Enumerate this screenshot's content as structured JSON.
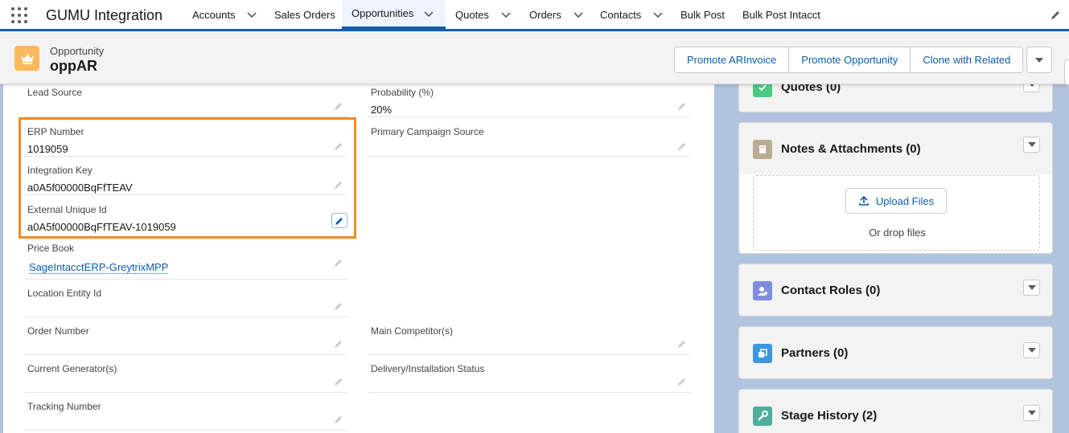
{
  "app": {
    "name": "GUMU Integration"
  },
  "nav": {
    "items": [
      {
        "label": "Accounts"
      },
      {
        "label": "Sales Orders"
      },
      {
        "label": "Opportunities"
      },
      {
        "label": "Quotes"
      },
      {
        "label": "Orders"
      },
      {
        "label": "Contacts"
      },
      {
        "label": "Bulk Post"
      },
      {
        "label": "Bulk Post Intacct"
      }
    ],
    "active": "Opportunities"
  },
  "record": {
    "type": "Opportunity",
    "name": "oppAR",
    "actions": [
      "Promote ARInvoice",
      "Promote Opportunity",
      "Clone with Related"
    ]
  },
  "fields": {
    "left": [
      {
        "label": "Lead Source",
        "value": ""
      },
      {
        "label": "ERP Number",
        "value": "1019059"
      },
      {
        "label": "Integration Key",
        "value": "a0A5f00000BqFfTEAV"
      },
      {
        "label": "External Unique Id",
        "value": "a0A5f00000BqFfTEAV-1019059"
      },
      {
        "label": "Price Book",
        "value": "SageIntacctERP-GreytrixMPP"
      },
      {
        "label": "Location Entity Id",
        "value": ""
      },
      {
        "label": "Order Number",
        "value": ""
      },
      {
        "label": "Current Generator(s)",
        "value": ""
      },
      {
        "label": "Tracking Number",
        "value": ""
      }
    ],
    "right": [
      {
        "label": "Probability (%)",
        "value": "20%"
      },
      {
        "label": "Primary Campaign Source",
        "value": ""
      },
      {
        "label": "Main Competitor(s)",
        "value": ""
      },
      {
        "label": "Delivery/Installation Status",
        "value": ""
      }
    ]
  },
  "related": {
    "quotes": {
      "title": "Quotes (0)",
      "color": "#4bca81"
    },
    "notes": {
      "title": "Notes & Attachments (0)",
      "color": "#baac93",
      "upload_label": "Upload Files",
      "drop_text": "Or drop files"
    },
    "contact_roles": {
      "title": "Contact Roles (0)",
      "color": "#7f8de1"
    },
    "partners": {
      "title": "Partners (0)",
      "color": "#3c97dd"
    },
    "stage_history": {
      "title": "Stage History (2)",
      "color": "#4fad9b"
    }
  },
  "colors": {
    "brand": "#1b5eb6",
    "link": "#0b5cab",
    "highlight": "#f28a24",
    "opportunity_icon": "#fcb95b"
  }
}
